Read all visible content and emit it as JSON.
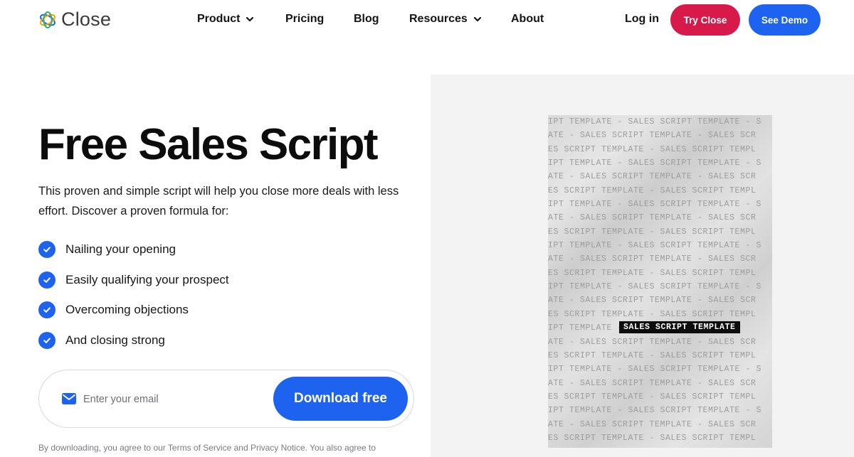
{
  "brand": {
    "name": "Close"
  },
  "nav": {
    "product": "Product",
    "pricing": "Pricing",
    "blog": "Blog",
    "resources": "Resources",
    "about": "About",
    "login": "Log in",
    "try_close": "Try Close",
    "see_demo": "See Demo"
  },
  "hero": {
    "title": "Free Sales Script",
    "description": "This proven and simple script will help you close more deals with less effort. Discover a proven formula for:",
    "bullets": [
      "Nailing your opening",
      "Easily qualifying your prospect",
      "Overcoming objections",
      "And closing strong"
    ]
  },
  "form": {
    "email_placeholder": "Enter your email",
    "email_value": "",
    "submit_label": "Download free"
  },
  "fineprint": "By downloading, you agree to our Terms of Service and Privacy Notice. You also agree to",
  "cover": {
    "line_a": "IPT TEMPLATE - SALES SCRIPT TEMPLATE - S",
    "line_b": "ATE - SALES SCRIPT TEMPLATE - SALES SCR",
    "line_c": "ES SCRIPT TEMPLATE - SALES SCRIPT TEMPL",
    "highlight_row_prefix": "IPT TEMPLATE -",
    "label": "SALES SCRIPT TEMPLATE"
  },
  "colors": {
    "primary_blue": "#1e63f0",
    "brand_red": "#d81a4a",
    "panel_bg": "#f4f3f4"
  },
  "icons": {
    "logo": "close-logo-icon",
    "chevron": "chevron-down-icon",
    "check": "check-circle-icon",
    "mail": "mail-icon"
  }
}
